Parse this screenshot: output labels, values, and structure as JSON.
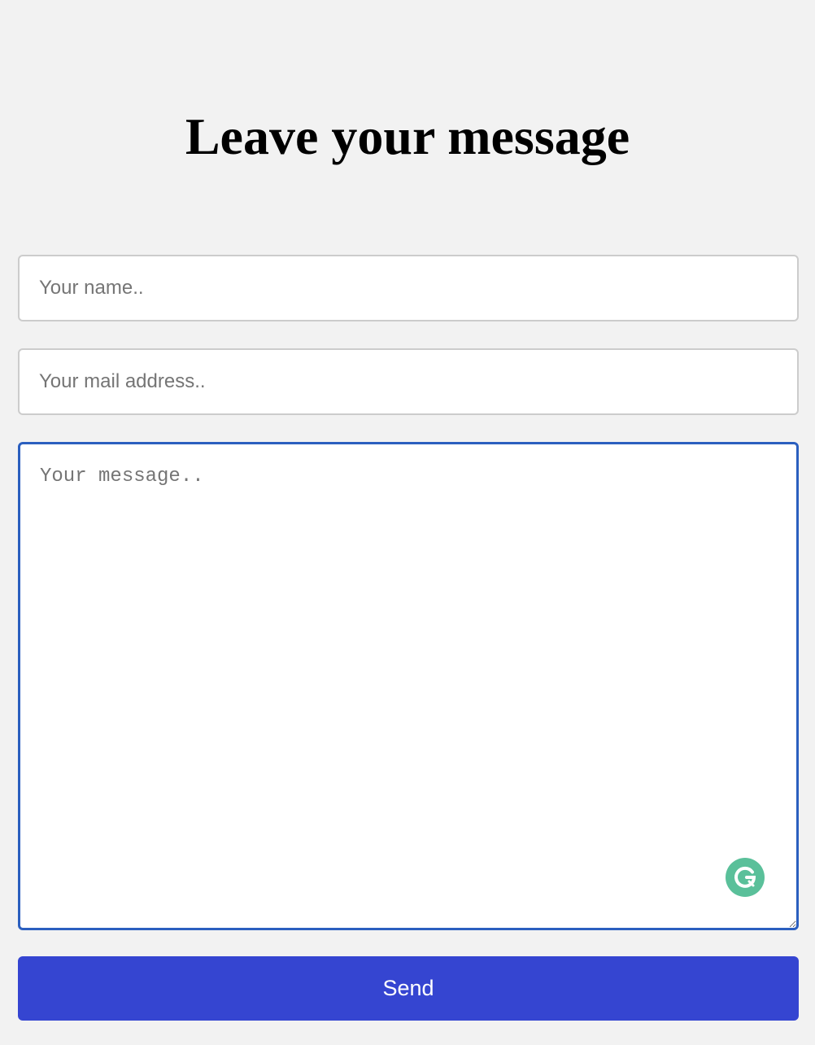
{
  "page": {
    "title": "Leave your message"
  },
  "form": {
    "name_placeholder": "Your name..",
    "name_value": "",
    "email_placeholder": "Your mail address..",
    "email_value": "",
    "message_placeholder": "Your message..",
    "message_value": "",
    "send_label": "Send"
  },
  "extension": {
    "icon": "grammarly-icon"
  },
  "colors": {
    "background": "#f2f2f2",
    "button": "#3545d1",
    "focus_border": "#2b5fbf",
    "grammarly": "#5ac09a"
  }
}
